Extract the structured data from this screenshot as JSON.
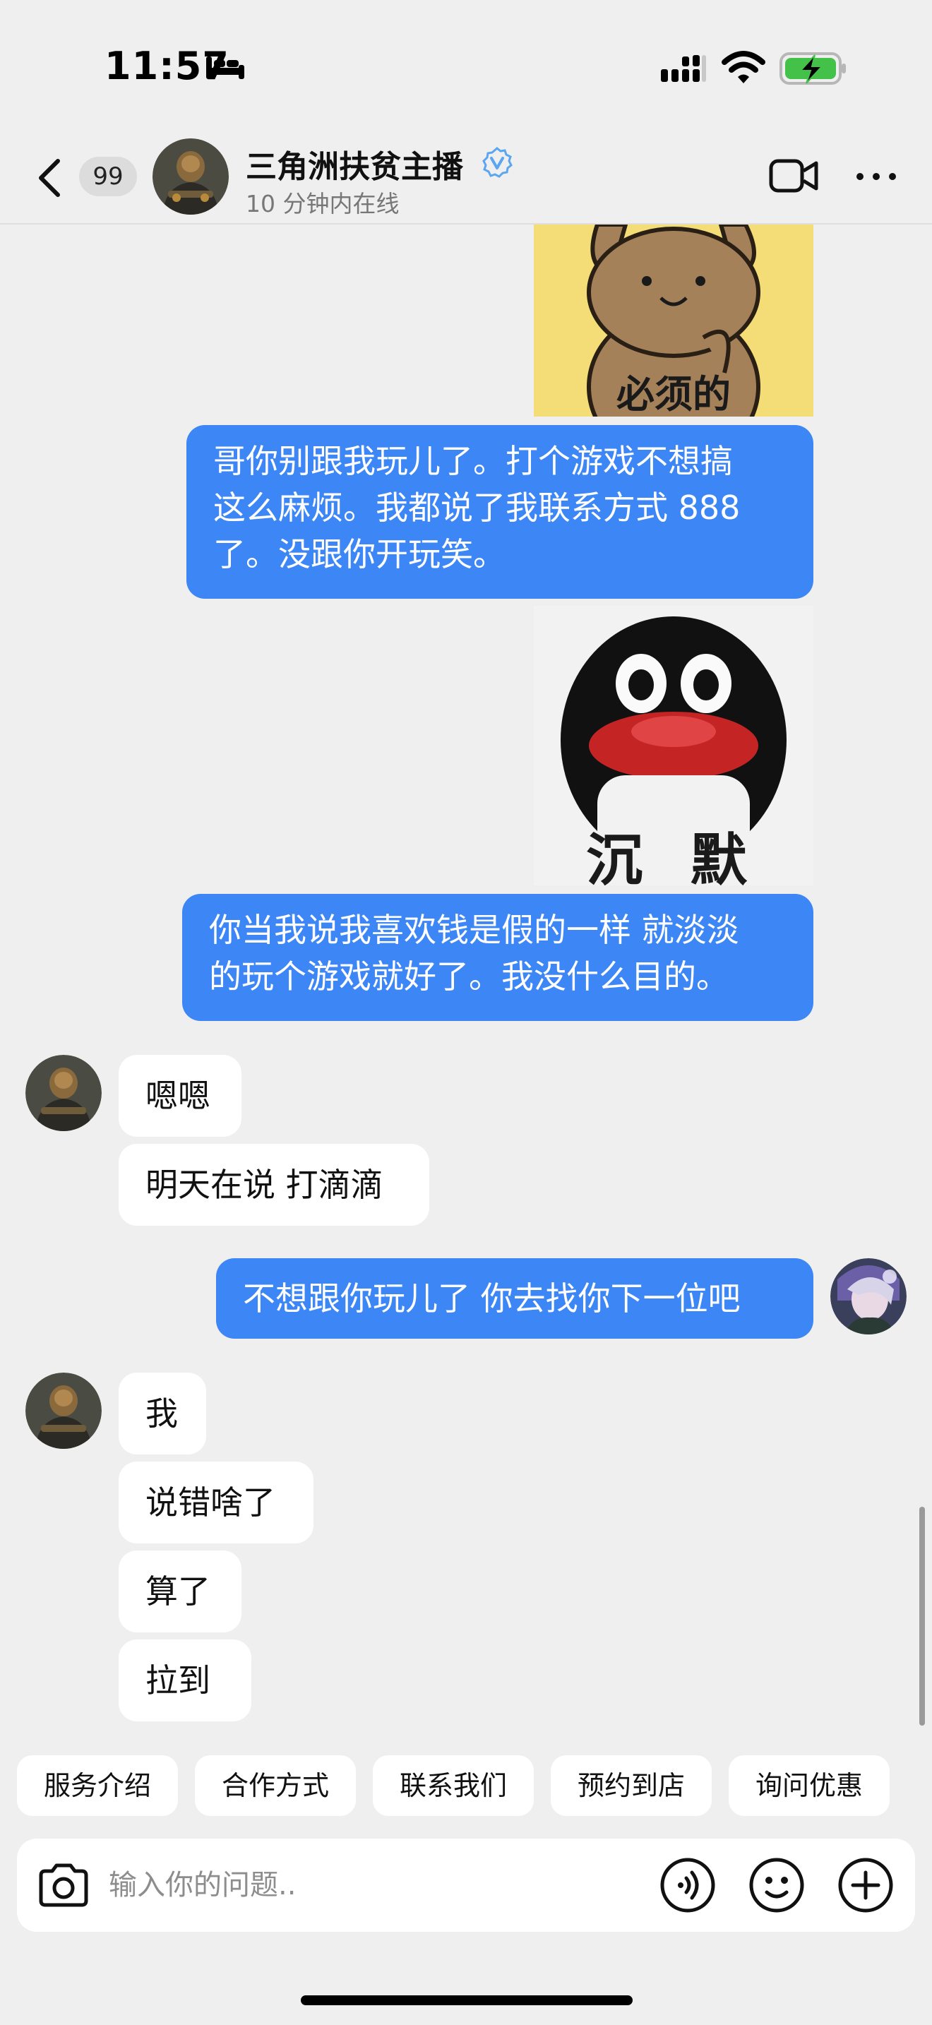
{
  "status_bar": {
    "time": "11:57"
  },
  "header": {
    "unread_count": "99",
    "contact_name": "三角洲扶贫主播",
    "contact_status": "10 分钟内在线"
  },
  "messages": {
    "sticker_bunny_caption": "必须的",
    "out_1": [
      "哥你别跟我玩儿了。打个游戏不想搞",
      "这么麻烦。我都说了我联系方式 888",
      "了。没跟你开玩笑。"
    ],
    "sticker_penguin_caption": "沉 默",
    "out_2": [
      "你当我说我喜欢钱是假的一样 就淡淡",
      "的玩个游戏就好了。我没什么目的。"
    ],
    "in_1": "嗯嗯",
    "in_2": "明天在说 打滴滴",
    "out_3": "不想跟你玩儿了 你去找你下一位吧",
    "in_3": "我",
    "in_4": "说错啥了",
    "in_5": "算了",
    "in_6": "拉到"
  },
  "quick_replies": [
    "服务介绍",
    "合作方式",
    "联系我们",
    "预约到店",
    "询问优惠"
  ],
  "input": {
    "placeholder": "输入你的问题.."
  },
  "colors": {
    "outgoing_bubble": "#3d86f6",
    "verified_blue": "#5aa6f0",
    "battery_green": "#43c148"
  }
}
